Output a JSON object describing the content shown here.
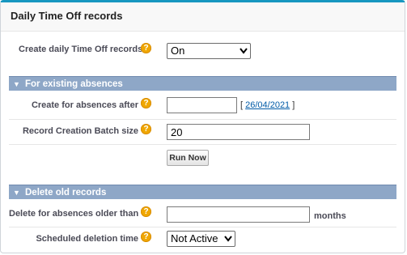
{
  "panel": {
    "title": "Daily Time Off records"
  },
  "general": {
    "create_label": "Create daily Time Off records",
    "create_value": "On"
  },
  "existing": {
    "section_title": "For existing absences",
    "after_label": "Create for absences after",
    "after_value": "",
    "date_open": "[ ",
    "date_link": "26/04/2021",
    "date_close": " ]",
    "batch_label": "Record Creation Batch size",
    "batch_value": "20",
    "run_label": "Run Now"
  },
  "delete": {
    "section_title": "Delete old records",
    "older_label": "Delete for absences older than",
    "older_value": "",
    "months_label": "months",
    "schedule_label": "Scheduled deletion time",
    "schedule_value": "Not Active"
  },
  "icons": {
    "help": "help-icon",
    "section_toggle": "triangle-down-icon",
    "select_arrow": "chevron-down-icon"
  },
  "colors": {
    "accent_top": "#1797c0",
    "section_bar": "#8ea7c7",
    "help_icon": "#f0a700",
    "link": "#015ba7"
  }
}
